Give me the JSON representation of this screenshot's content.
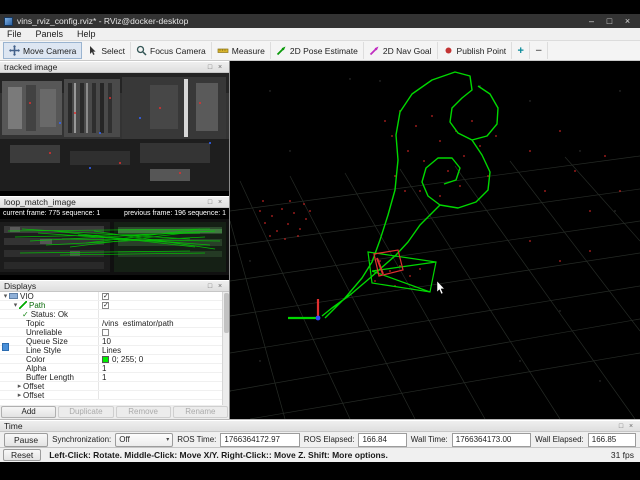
{
  "titlebar": {
    "title": "vins_rviz_config.rviz* - RViz@docker-desktop"
  },
  "menu": {
    "items": [
      "File",
      "Panels",
      "Help"
    ]
  },
  "toolbar": {
    "items": [
      {
        "label": "Move Camera"
      },
      {
        "label": "Select"
      },
      {
        "label": "Focus Camera"
      },
      {
        "label": "Measure"
      },
      {
        "label": "2D Pose Estimate"
      },
      {
        "label": "2D Nav Goal"
      },
      {
        "label": "Publish Point"
      }
    ]
  },
  "tracked_panel": {
    "title": "tracked image"
  },
  "loop_panel": {
    "title": "loop_match_image",
    "current_info": "current frame: 775  sequence: 1",
    "previous_info": "previous frame: 196  sequence: 1"
  },
  "displays": {
    "title": "Displays",
    "rows": [
      {
        "label": "VIO",
        "value": ""
      },
      {
        "label": "Path",
        "value": ""
      },
      {
        "label": "Status: Ok",
        "value": ""
      },
      {
        "label": "Topic",
        "value": "/vins_estimator/path"
      },
      {
        "label": "Unreliable",
        "value": ""
      },
      {
        "label": "Queue Size",
        "value": "10"
      },
      {
        "label": "Line Style",
        "value": "Lines"
      },
      {
        "label": "Color",
        "value": "0; 255; 0"
      },
      {
        "label": "Alpha",
        "value": "1"
      },
      {
        "label": "Buffer Length",
        "value": "1"
      },
      {
        "label": "Offset",
        "value": ""
      },
      {
        "label": "Offset",
        "value": ""
      }
    ],
    "buttons": {
      "add": "Add",
      "duplicate": "Duplicate",
      "remove": "Remove",
      "rename": "Rename"
    }
  },
  "time_panel": {
    "title": "Time",
    "pause": "Pause",
    "sync_label": "Synchronization:",
    "sync_value": "Off",
    "ros_time_label": "ROS Time:",
    "ros_time": "1766364172.97",
    "ros_elapsed_label": "ROS Elapsed:",
    "ros_elapsed": "166.84",
    "wall_time_label": "Wall Time:",
    "wall_time": "1766364173.00",
    "wall_elapsed_label": "Wall Elapsed:",
    "wall_elapsed": "166.85"
  },
  "statusbar": {
    "reset": "Reset",
    "hint": "Left-Click: Rotate.  Middle-Click: Move X/Y.  Right-Click:: Move Z.  Shift: More options.",
    "fps": "31 fps"
  },
  "icons": {
    "minimize": "–",
    "maximize": "□",
    "close": "×",
    "float": "□",
    "chevron_down": "▾",
    "chevron_right": "▸",
    "check": "✓",
    "plus": "+",
    "minus": "−"
  },
  "colors": {
    "path_green": "#00d800",
    "point_red": "#c22222",
    "swatch_green": "#00ff00",
    "frustum_red": "#e03030",
    "axis_blue": "#2d4bff"
  }
}
